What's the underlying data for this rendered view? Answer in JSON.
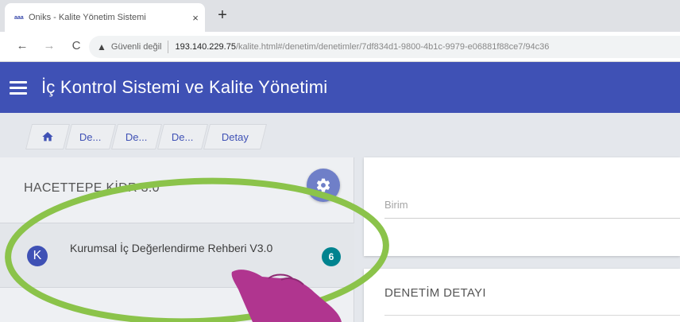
{
  "browser": {
    "tab": {
      "favicon_text": "aaa",
      "title": "Oniks - Kalite Yönetim Sistemi",
      "close_glyph": "×"
    },
    "new_tab_glyph": "+",
    "address": {
      "security_label": "Güvenli değil",
      "url_host": "193.140.229.75",
      "url_path": "/kalite.html#/denetim/denetimler/7df834d1-9800-4b1c-9979-e06881f88ce7/94c36"
    }
  },
  "app": {
    "title": "İç Kontrol Sistemi ve Kalite Yönetimi"
  },
  "breadcrumb": {
    "items": [
      "De...",
      "De...",
      "De...",
      "Detay"
    ]
  },
  "left_panel": {
    "heading": "HACETTEPE KİDR 3.0",
    "items": [
      {
        "avatar_letter": "K",
        "label": "Kurumsal İç Değerlendirme Rehberi V3.0",
        "badge_count": "6"
      }
    ]
  },
  "right_panel": {
    "birim_label": "Birim",
    "detail_title": "DENETİM DETAYI"
  },
  "colors": {
    "appbar": "#3f51b5",
    "badge": "#00838f",
    "settings_button": "#6f7fc8",
    "highlight_ring": "#8bc34a",
    "pointer_hand": "#b0358f"
  },
  "icons": {
    "menu": "hamburger-menu-icon",
    "home": "home-icon",
    "settings": "gear-icon",
    "warning": "warning-triangle-icon",
    "pointer": "pointing-hand-icon"
  }
}
